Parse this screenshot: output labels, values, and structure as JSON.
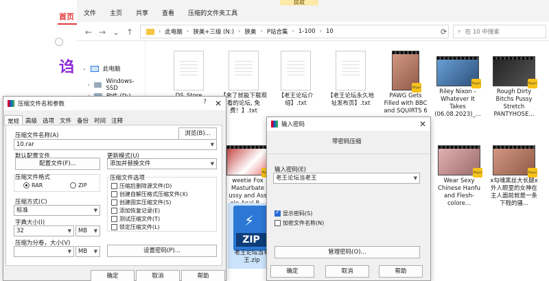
{
  "browser": {
    "home": "首页",
    "ad_char": "诌"
  },
  "explorer": {
    "ribbon_tabs": [
      "文件",
      "主页",
      "共享",
      "查看",
      "压缩的文件夹工具"
    ],
    "extract_tab": "提取",
    "breadcrumb": [
      "此电脑",
      "狭美+三级 (N:)",
      "狭美",
      "P站合集",
      "1-100",
      "10"
    ],
    "search_placeholder": "在 10 中搜索",
    "nav_items": [
      "此电脑",
      "Windows-SSD",
      "软件 (D:)"
    ],
    "files": [
      {
        "name": "DS_Store",
        "kind": "doc"
      },
      {
        "name": "【来了就能下载观看的论坛, 免费！】.txt",
        "kind": "doc"
      },
      {
        "name": "【老王论坛介绍】.txt",
        "kind": "doc"
      },
      {
        "name": "【老王论坛永久地址发布页】.txt",
        "kind": "doc"
      },
      {
        "name": "PAWG Gets Filled with BBC and SQUIRTS 6",
        "kind": "vid"
      },
      {
        "name": "Riley Nixon - Whatever It Takes (06.08.2023)_...",
        "kind": "vid"
      },
      {
        "name": "Rough Dirty Bitchs Pussy Stretch PANTYHOSE...",
        "kind": "vid"
      },
      {
        "name": "weetie Fox Masturbate ussy and Ass ole Anal B...",
        "kind": "vid"
      },
      {
        "name": "Wear Sexy Chinese Hanfu and Flesh-colore...",
        "kind": "vid"
      },
      {
        "name": "x勾魂黑丝大长腿x外人眼里的女神在主人面前就是一条下贱的骚...",
        "kind": "vid"
      },
      {
        "name": "老王论坛当老王.zip",
        "kind": "zip"
      }
    ],
    "zip_label": "ZIP"
  },
  "archive_dialog": {
    "title": "压缩文件名和参数",
    "help": "?",
    "tabs": [
      "常规",
      "高级",
      "选项",
      "文件",
      "备份",
      "时间",
      "注释"
    ],
    "archive_name_label": "压缩文件名称(A)",
    "archive_name_value": "10.rar",
    "browse_button": "浏览(B)...",
    "default_profile_label": "默认配置文件",
    "profile_button": "配置文件(F)...",
    "update_mode_label": "更新模式(U)",
    "update_mode_value": "添加并替换文件",
    "format_label": "压缩文件格式",
    "format_rar": "RAR",
    "format_zip": "ZIP",
    "method_label": "压缩方式(C)",
    "method_value": "标准",
    "dict_label": "字典大小(I)",
    "dict_value": "32",
    "dict_unit": "MB",
    "split_label": "压缩为分卷，大小(V)",
    "split_unit": "MB",
    "options_label": "压缩文件选项",
    "options": [
      {
        "label": "压缩后删除源文件(D)",
        "checked": false
      },
      {
        "label": "创建自解压格式压缩文件(X)",
        "checked": false
      },
      {
        "label": "创建固实压缩文件(S)",
        "checked": false
      },
      {
        "label": "添加恢复记录(E)",
        "checked": false
      },
      {
        "label": "测试压缩文件(T)",
        "checked": false
      },
      {
        "label": "锁定压缩文件(L)",
        "checked": false
      }
    ],
    "set_password_button": "设置密码(P)...",
    "ok": "确定",
    "cancel": "取消",
    "help_button": "帮助"
  },
  "password_dialog": {
    "title": "输入密码",
    "subtitle": "带密码压缩",
    "input_label": "输入密码(E)",
    "input_value": "老王论坛当老王",
    "show_password": "显示密码(S)",
    "encrypt_names": "加密文件名称(N)",
    "manage_button": "管理密码(O)...",
    "ok": "确定",
    "cancel": "取消",
    "help": "帮助"
  }
}
